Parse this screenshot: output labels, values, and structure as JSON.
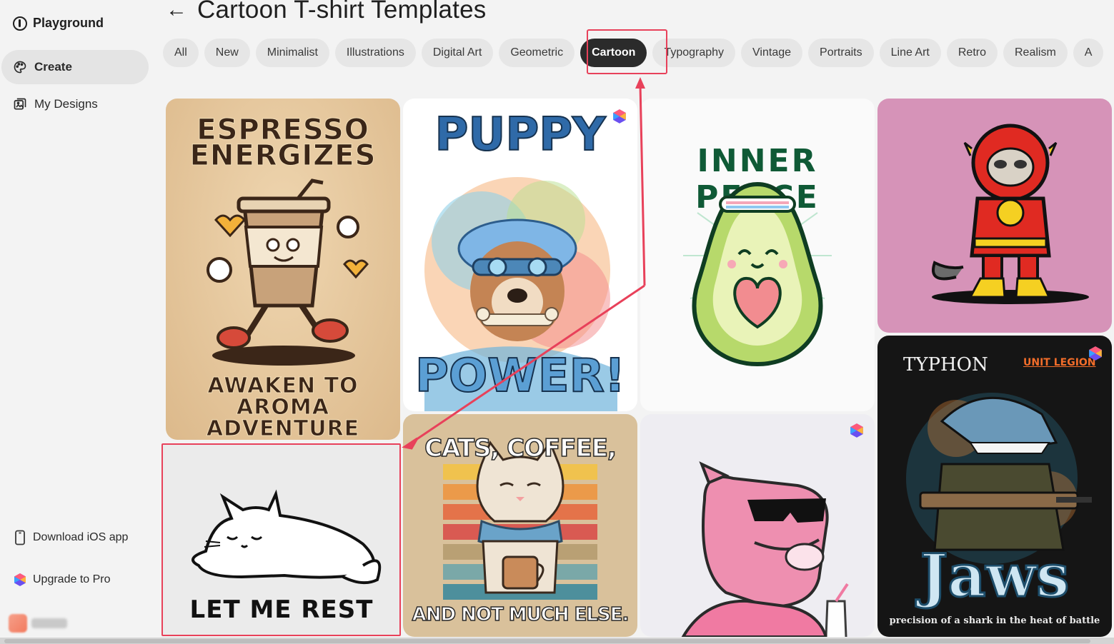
{
  "sidebar": {
    "brand": "Playground",
    "nav": [
      {
        "label": "Create",
        "icon": "palette-icon",
        "active": true
      },
      {
        "label": "My Designs",
        "icon": "designs-icon",
        "active": false
      }
    ],
    "download_ios": "Download iOS app",
    "upgrade": "Upgrade to Pro"
  },
  "header": {
    "title": "Cartoon T-shirt Templates"
  },
  "filters": {
    "chips": [
      "All",
      "New",
      "Minimalist",
      "Illustrations",
      "Digital Art",
      "Geometric",
      "Cartoon",
      "Typography",
      "Vintage",
      "Portraits",
      "Line Art",
      "Retro",
      "Realism",
      "A"
    ],
    "selected": "Cartoon"
  },
  "templates": {
    "espresso": {
      "title_line1": "ESPRESSO",
      "title_line2": "ENERGIZES",
      "sub_line1": "AWAKEN TO",
      "sub_line2": "AROMA ADVENTURE"
    },
    "puppy": {
      "title_top": "PUPPY",
      "title_bottom": "POWER!"
    },
    "avocado": {
      "title": "INNER PEACE"
    },
    "sloth": {},
    "shark": {
      "top_left": "TYPHON",
      "top_right": "UNIT LEGION",
      "title": "Jaws",
      "tagline": "precision of a shark in the heat of battle"
    },
    "cats": {
      "title_top": "CATS, COFFEE,",
      "title_bottom": "AND NOT MUCH ELSE."
    },
    "panther": {},
    "rest": {
      "title": "LET ME REST"
    }
  },
  "colors": {
    "accent_highlight": "#e8415a",
    "chip_active_bg": "#2b2b2b",
    "chip_bg": "#e6e6e6"
  }
}
